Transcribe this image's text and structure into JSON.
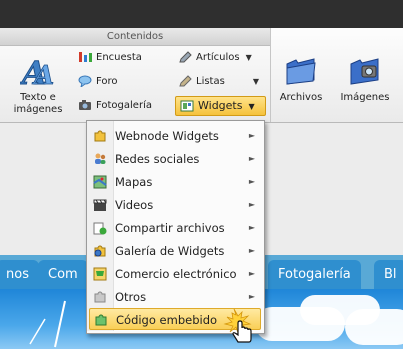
{
  "ribbon": {
    "group_title": "Contenidos",
    "texto_imagenes": "Texto e imágenes",
    "encuesta": "Encuesta",
    "foro": "Foro",
    "fotogaleria": "Fotogalería",
    "articulos": "Artículos",
    "listas": "Listas",
    "widgets": "Widgets",
    "archivos": "Archivos",
    "imagenes": "Imágenes"
  },
  "menu": {
    "items": [
      {
        "label": "Webnode Widgets",
        "icon": "puzzle-icon"
      },
      {
        "label": "Redes sociales",
        "icon": "users-icon"
      },
      {
        "label": "Mapas",
        "icon": "map-icon"
      },
      {
        "label": "Videos",
        "icon": "clapperboard-icon"
      },
      {
        "label": "Compartir archivos",
        "icon": "share-file-icon"
      },
      {
        "label": "Galería de Widgets",
        "icon": "gear-puzzle-icon"
      },
      {
        "label": "Comercio electrónico",
        "icon": "cart-icon"
      },
      {
        "label": "Otros",
        "icon": "puzzle-gray-icon"
      },
      {
        "label": "Código embebido",
        "icon": "puzzle-green-icon"
      }
    ],
    "highlighted_index": 8
  },
  "tabs": [
    "nos",
    "Com",
    "Fotogalería",
    "Bl"
  ],
  "colors": {
    "accent": "#f5c23c",
    "tab": "#2f8fcf"
  }
}
